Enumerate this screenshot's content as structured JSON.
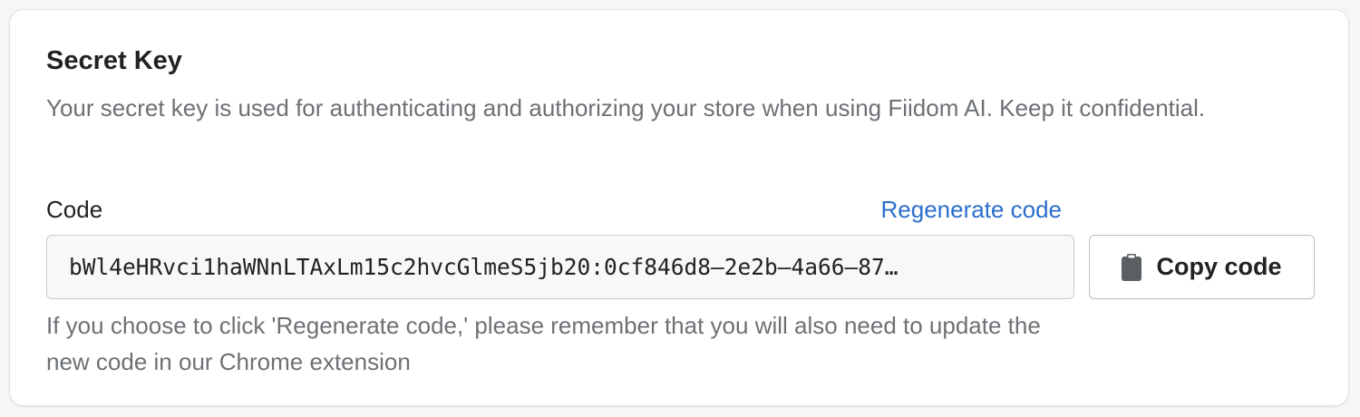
{
  "card": {
    "title": "Secret Key",
    "description": "Your secret key is used for authenticating and authorizing your store when using Fiidom AI. Keep it confidential."
  },
  "code_field": {
    "label": "Code",
    "regenerate_label": "Regenerate code",
    "value": "bWl4eHRvci1haWNnLTAxLm15c2hvcGlmeS5jb20:0cf846d8–2e2b–4a66–87…",
    "copy_button_label": "Copy code",
    "copy_icon": "clipboard-icon",
    "help_text": "If you choose to click 'Regenerate code,' please remember that you will also need to update the new code in our Chrome extension"
  },
  "colors": {
    "link": "#2c6ecb",
    "text_primary": "#202223",
    "text_secondary": "#6d7175",
    "field_background": "#f7f8f7"
  }
}
